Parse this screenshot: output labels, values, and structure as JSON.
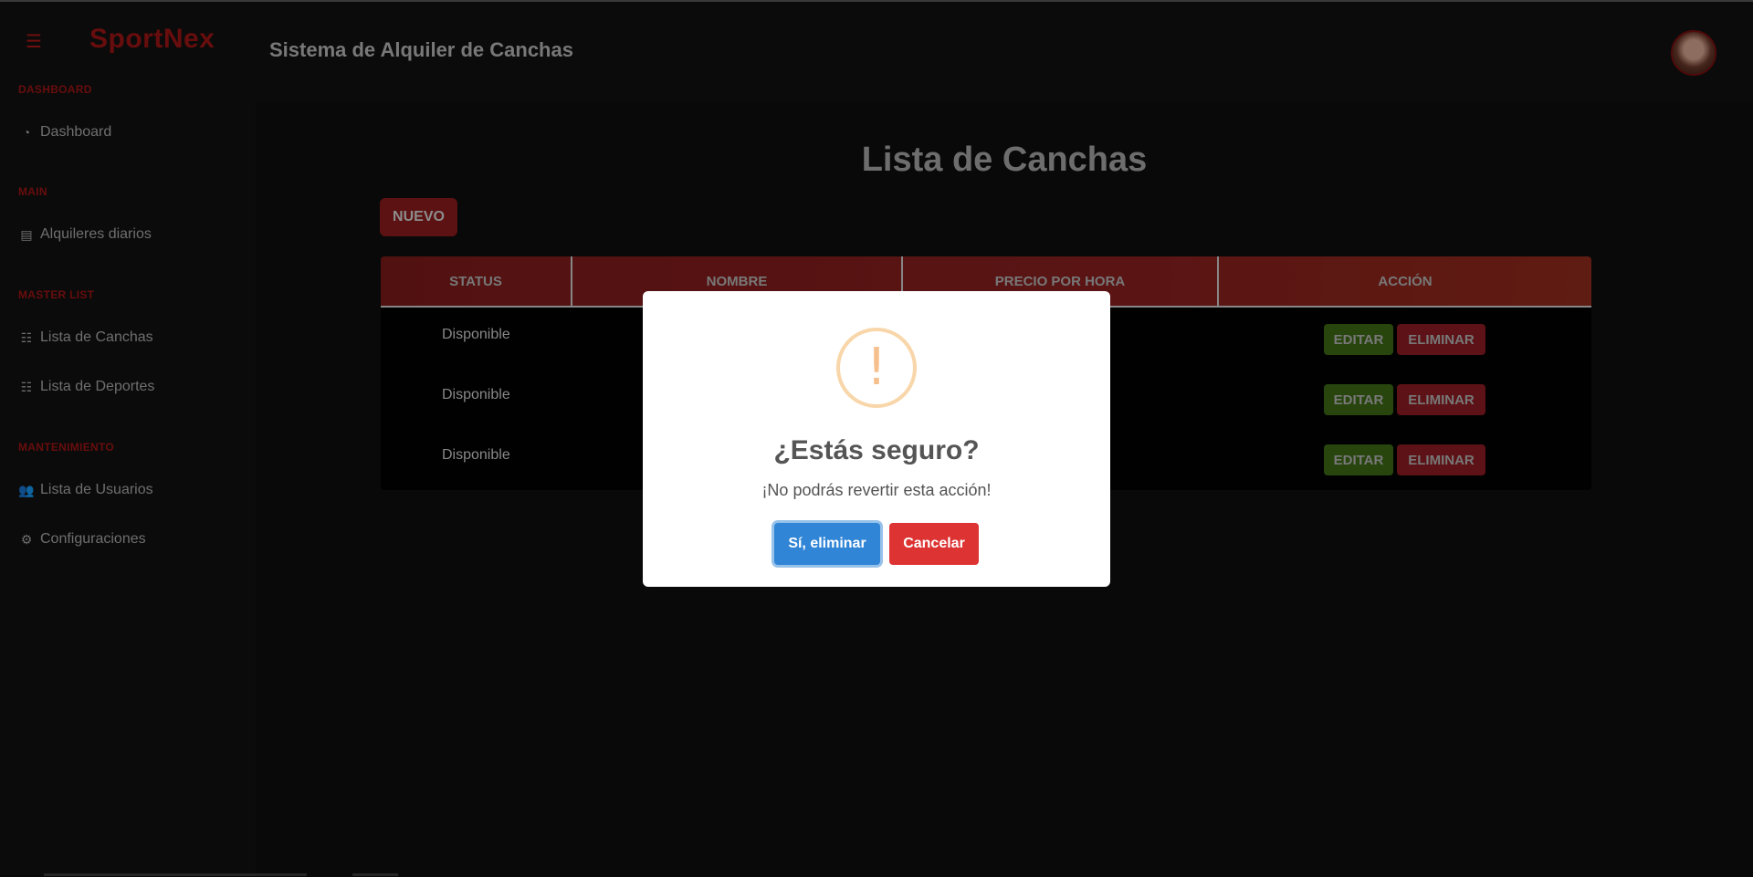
{
  "app": {
    "brand": "SportNex",
    "header_title": "Sistema de Alquiler de Canchas"
  },
  "icons": {
    "menu": "☰",
    "dashboard": "◔",
    "document": "▤",
    "list": "☷",
    "users": "👥",
    "gear": "⚙"
  },
  "colors": {
    "accent": "#a01414",
    "confirm": "#3085d6",
    "cancel": "#dd3333",
    "edit": "#3c6b14"
  },
  "sidebar": {
    "sections": [
      {
        "title": "DASHBOARD",
        "items": [
          {
            "label": "Dashboard",
            "icon": "dashboard-icon"
          }
        ]
      },
      {
        "title": "MAIN",
        "items": [
          {
            "label": "Alquileres diarios",
            "icon": "document-icon"
          }
        ]
      },
      {
        "title": "MASTER LIST",
        "items": [
          {
            "label": "Lista de Canchas",
            "icon": "list-icon"
          },
          {
            "label": "Lista de Deportes",
            "icon": "list-icon"
          }
        ]
      },
      {
        "title": "MANTENIMIENTO",
        "items": [
          {
            "label": "Lista de Usuarios",
            "icon": "users-icon"
          },
          {
            "label": "Configuraciones",
            "icon": "gear-icon"
          }
        ]
      }
    ]
  },
  "main": {
    "title": "Lista de Canchas",
    "new_button": "NUEVO",
    "table": {
      "headers": [
        "STATUS",
        "NOMBRE",
        "PRECIO POR HORA",
        "ACCIÓN"
      ],
      "rows": [
        {
          "status": "Disponible",
          "nombre": "",
          "precio": ""
        },
        {
          "status": "Disponible",
          "nombre": "",
          "precio": ""
        },
        {
          "status": "Disponible",
          "nombre": "",
          "precio": ""
        }
      ],
      "edit_label": "EDITAR",
      "delete_label": "ELIMINAR"
    }
  },
  "modal": {
    "icon": "!",
    "title": "¿Estás seguro?",
    "text": "¡No podrás revertir esta acción!",
    "confirm_label": "Sí, eliminar",
    "cancel_label": "Cancelar"
  }
}
